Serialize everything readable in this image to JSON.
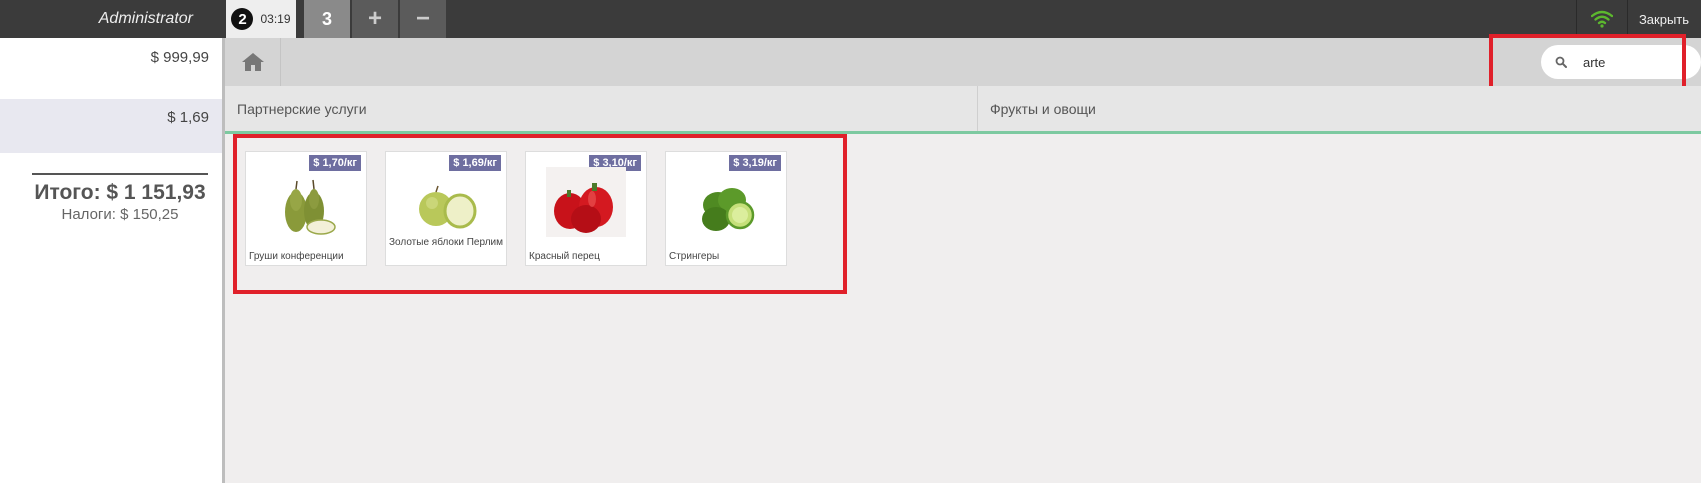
{
  "topbar": {
    "user": "Administrator",
    "active_order": {
      "number": "2",
      "time": "03:19"
    },
    "other_order": "3",
    "add_label": "+",
    "remove_label": "−",
    "close_label": "Закрыть"
  },
  "order": {
    "lines": [
      {
        "price": "$ 999,99"
      },
      {
        "price": "$ 1,69"
      }
    ],
    "total": "Итого: $ 1 151,93",
    "taxes": "Налоги: $ 150,25"
  },
  "search": {
    "value": "arte"
  },
  "categories": [
    "Партнерские услуги",
    "Фрукты и овощи"
  ],
  "products": [
    {
      "name": "Груши конференции",
      "price": "$ 1,70/кг"
    },
    {
      "name": "Золотые яблоки Перлим",
      "price": "$ 1,69/кг"
    },
    {
      "name": "Красный перец",
      "price": "$ 3,10/кг"
    },
    {
      "name": "Стрингеры",
      "price": "$ 3,19/кг"
    }
  ],
  "colors": {
    "topbar": "#3b3b3b",
    "price_badge": "#6e6ea0",
    "category_underline": "#7dc9a0",
    "highlight": "#e0202a",
    "wifi": "#5cb82e"
  }
}
